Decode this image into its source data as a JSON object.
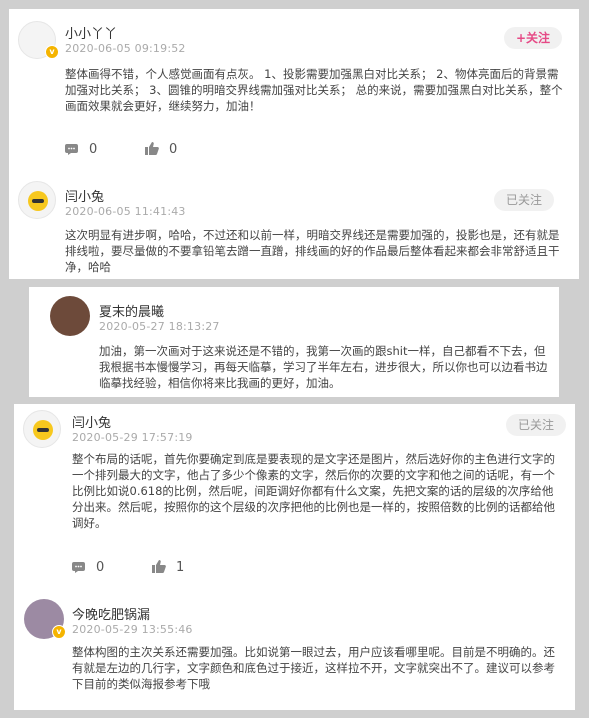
{
  "comments": [
    {
      "name": "小小丫丫",
      "time": "2020-06-05 09:19:52",
      "follow": "+关注",
      "text": "整体画得不错，个人感觉画面有点灰。 1、投影需要加强黑白对比关系； 2、物体亮面后的背景需加强对比关系； 3、圆锥的明暗交界线需加强对比关系； 总的来说，需要加强黑白对比关系，整个画面效果就会更好，继续努力，加油！",
      "comments_count": "0",
      "likes_count": "0"
    },
    {
      "name": "闫小兔",
      "time": "2020-06-05 11:41:43",
      "follow": "已关注",
      "text": "这次明显有进步啊，哈哈，不过还和以前一样，明暗交界线还是需要加强的，投影也是，还有就是排线啦，要尽量做的不要拿铅笔去蹭一直蹭，排线画的好的作品最后整体看起来都会非常舒适且干净，哈哈"
    },
    {
      "name": "夏末的晨曦",
      "time": "2020-05-27 18:13:27",
      "text": "加油，第一次画对于这来说还是不错的，我第一次画的跟shit一样，自己都看不下去，但我根据书本慢慢学习，再每天临摹，学习了半年左右，进步很大，所以你也可以边看书边临摹找经验，相信你将来比我画的更好，加油。"
    },
    {
      "name": "闫小兔",
      "time": "2020-05-29 17:57:19",
      "follow": "已关注",
      "text": "整个布局的话呢，首先你要确定到底是要表现的是文字还是图片，然后选好你的主色进行文字的一个排列最大的文字，他占了多少个像素的文字，然后你的次要的文字和他之间的话呢，有一个比例比如说0.618的比例，然后呢，间距调好你都有什么文案，先把文案的话的层级的次序给他分出来。然后呢，按照你的这个层级的次序把他的比例也是一样的，按照倍数的比例的话都给他调好。",
      "comments_count": "0",
      "likes_count": "1"
    },
    {
      "name": "今晚吃肥锅漏",
      "time": "2020-05-29 13:55:46",
      "text": "整体构图的主次关系还需要加强。比如说第一眼过去，用户应该看哪里呢。目前是不明确的。还有就是左边的几行字，文字颜色和底色过于接近，这样拉不开，文字就突出不了。建议可以参考下目前的类似海报参考下哦"
    }
  ],
  "badge_symbol": "v"
}
